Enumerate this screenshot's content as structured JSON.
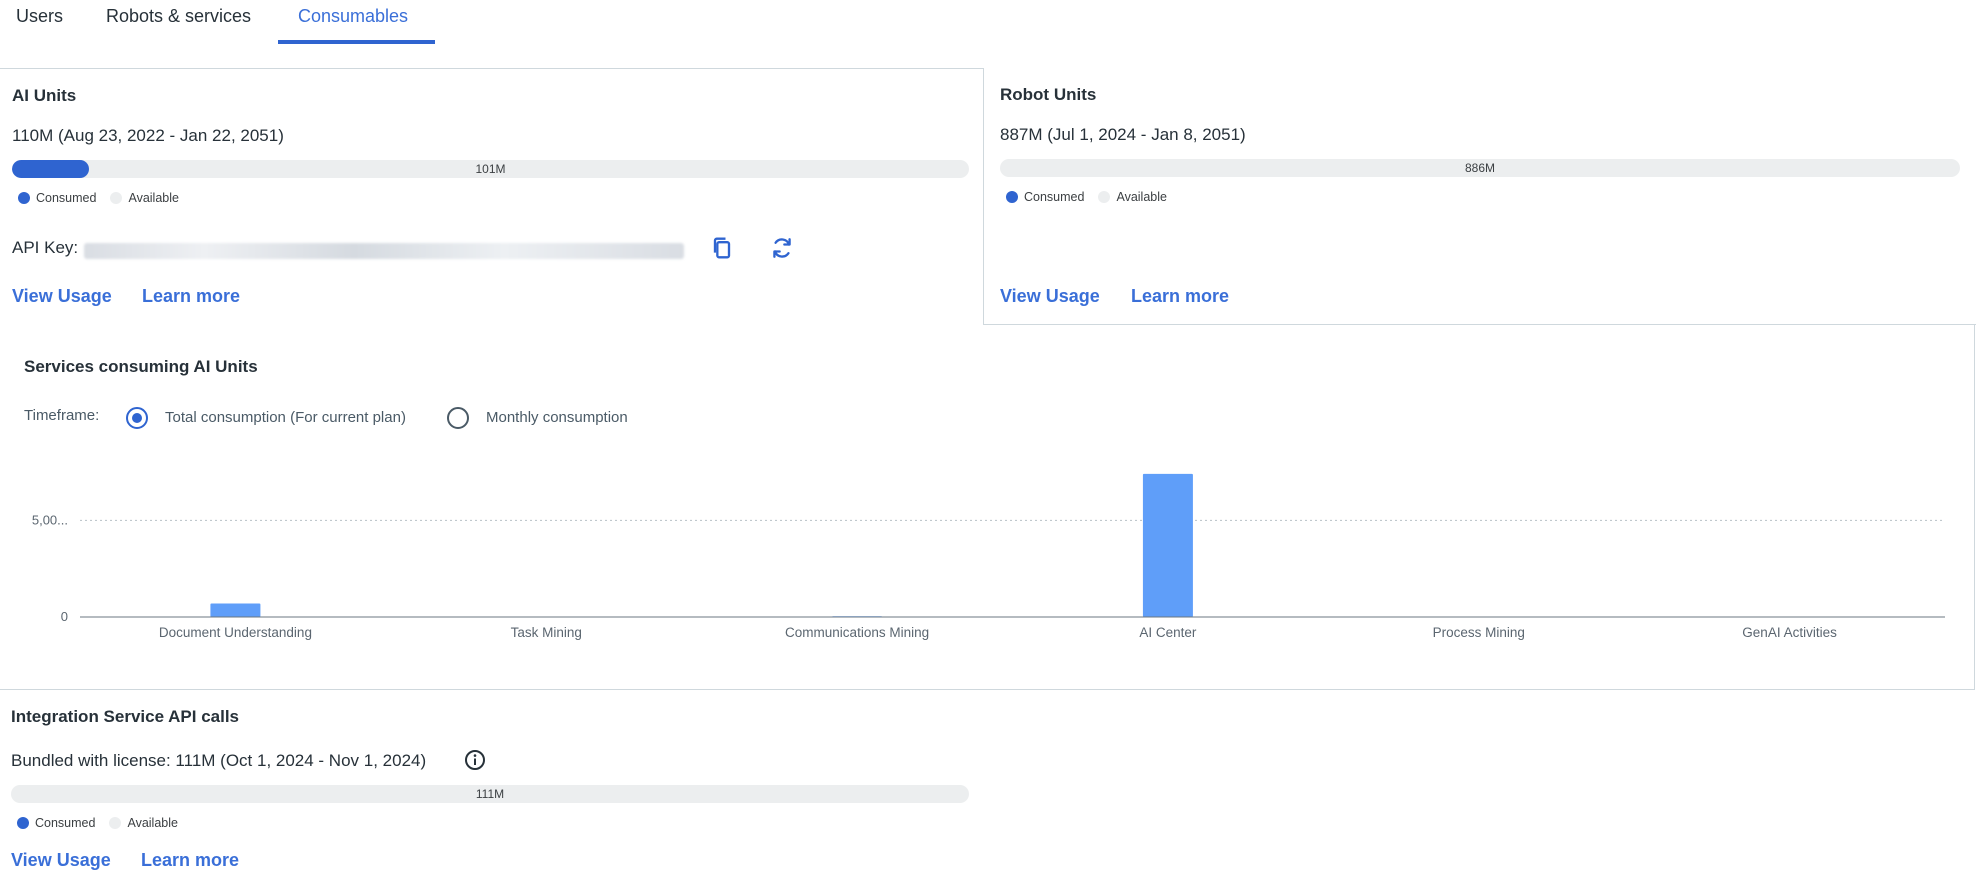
{
  "tabs": [
    {
      "label": "Users"
    },
    {
      "label": "Robots & services"
    },
    {
      "label": "Consumables",
      "active": true
    }
  ],
  "ai_units": {
    "title": "AI Units",
    "subtitle": "110M (Aug 23, 2022 - Jan 22, 2051)",
    "bar_label": "101M",
    "consumed_fraction": 0.08,
    "legend_consumed": "Consumed",
    "legend_available": "Available",
    "api_key_label": "API Key:",
    "view_usage": "View Usage",
    "learn_more": "Learn more"
  },
  "robot_units": {
    "title": "Robot Units",
    "subtitle": "887M (Jul 1, 2024 - Jan 8, 2051)",
    "bar_label": "886M",
    "consumed_fraction": 0.0,
    "legend_consumed": "Consumed",
    "legend_available": "Available",
    "view_usage": "View Usage",
    "learn_more": "Learn more"
  },
  "services": {
    "title": "Services consuming AI Units",
    "timeframe_label": "Timeframe:",
    "option_total": "Total consumption (For current plan)",
    "option_monthly": "Monthly consumption",
    "selected": "total"
  },
  "chart_data": {
    "type": "bar",
    "categories": [
      "Document Understanding",
      "Task Mining",
      "Communications Mining",
      "AI Center",
      "Process Mining",
      "GenAI Activities"
    ],
    "values": [
      700,
      0,
      40,
      7400,
      0,
      0
    ],
    "y_tick_labels": [
      "0",
      "5,00..."
    ],
    "y_ticks": [
      0,
      5000
    ],
    "ylim": [
      0,
      7500
    ],
    "grid": "dotted at 5,00...",
    "bar_color": "#5f9ef9"
  },
  "integration": {
    "title": "Integration Service API calls",
    "subtitle": "Bundled with license: 111M (Oct 1, 2024 - Nov 1, 2024)",
    "bar_label": "111M",
    "consumed_fraction": 0.0,
    "legend_consumed": "Consumed",
    "legend_available": "Available",
    "view_usage": "View Usage",
    "learn_more": "Learn more"
  },
  "colors": {
    "accent": "#2f64d0",
    "link": "#3a6fd8",
    "bar_track": "#eceeef",
    "chart_bar": "#5f9ef9"
  }
}
